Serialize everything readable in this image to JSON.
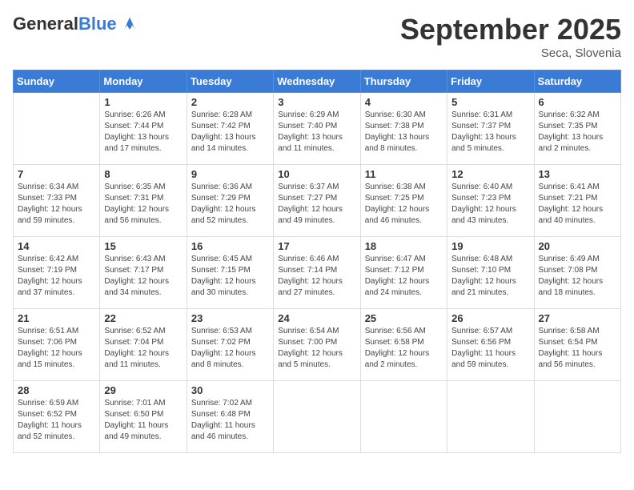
{
  "logo": {
    "general": "General",
    "blue": "Blue"
  },
  "header": {
    "month": "September 2025",
    "location": "Seca, Slovenia"
  },
  "weekdays": [
    "Sunday",
    "Monday",
    "Tuesday",
    "Wednesday",
    "Thursday",
    "Friday",
    "Saturday"
  ],
  "weeks": [
    [
      {
        "day": "",
        "sunrise": "",
        "sunset": "",
        "daylight": ""
      },
      {
        "day": "1",
        "sunrise": "Sunrise: 6:26 AM",
        "sunset": "Sunset: 7:44 PM",
        "daylight": "Daylight: 13 hours and 17 minutes."
      },
      {
        "day": "2",
        "sunrise": "Sunrise: 6:28 AM",
        "sunset": "Sunset: 7:42 PM",
        "daylight": "Daylight: 13 hours and 14 minutes."
      },
      {
        "day": "3",
        "sunrise": "Sunrise: 6:29 AM",
        "sunset": "Sunset: 7:40 PM",
        "daylight": "Daylight: 13 hours and 11 minutes."
      },
      {
        "day": "4",
        "sunrise": "Sunrise: 6:30 AM",
        "sunset": "Sunset: 7:38 PM",
        "daylight": "Daylight: 13 hours and 8 minutes."
      },
      {
        "day": "5",
        "sunrise": "Sunrise: 6:31 AM",
        "sunset": "Sunset: 7:37 PM",
        "daylight": "Daylight: 13 hours and 5 minutes."
      },
      {
        "day": "6",
        "sunrise": "Sunrise: 6:32 AM",
        "sunset": "Sunset: 7:35 PM",
        "daylight": "Daylight: 13 hours and 2 minutes."
      }
    ],
    [
      {
        "day": "7",
        "sunrise": "Sunrise: 6:34 AM",
        "sunset": "Sunset: 7:33 PM",
        "daylight": "Daylight: 12 hours and 59 minutes."
      },
      {
        "day": "8",
        "sunrise": "Sunrise: 6:35 AM",
        "sunset": "Sunset: 7:31 PM",
        "daylight": "Daylight: 12 hours and 56 minutes."
      },
      {
        "day": "9",
        "sunrise": "Sunrise: 6:36 AM",
        "sunset": "Sunset: 7:29 PM",
        "daylight": "Daylight: 12 hours and 52 minutes."
      },
      {
        "day": "10",
        "sunrise": "Sunrise: 6:37 AM",
        "sunset": "Sunset: 7:27 PM",
        "daylight": "Daylight: 12 hours and 49 minutes."
      },
      {
        "day": "11",
        "sunrise": "Sunrise: 6:38 AM",
        "sunset": "Sunset: 7:25 PM",
        "daylight": "Daylight: 12 hours and 46 minutes."
      },
      {
        "day": "12",
        "sunrise": "Sunrise: 6:40 AM",
        "sunset": "Sunset: 7:23 PM",
        "daylight": "Daylight: 12 hours and 43 minutes."
      },
      {
        "day": "13",
        "sunrise": "Sunrise: 6:41 AM",
        "sunset": "Sunset: 7:21 PM",
        "daylight": "Daylight: 12 hours and 40 minutes."
      }
    ],
    [
      {
        "day": "14",
        "sunrise": "Sunrise: 6:42 AM",
        "sunset": "Sunset: 7:19 PM",
        "daylight": "Daylight: 12 hours and 37 minutes."
      },
      {
        "day": "15",
        "sunrise": "Sunrise: 6:43 AM",
        "sunset": "Sunset: 7:17 PM",
        "daylight": "Daylight: 12 hours and 34 minutes."
      },
      {
        "day": "16",
        "sunrise": "Sunrise: 6:45 AM",
        "sunset": "Sunset: 7:15 PM",
        "daylight": "Daylight: 12 hours and 30 minutes."
      },
      {
        "day": "17",
        "sunrise": "Sunrise: 6:46 AM",
        "sunset": "Sunset: 7:14 PM",
        "daylight": "Daylight: 12 hours and 27 minutes."
      },
      {
        "day": "18",
        "sunrise": "Sunrise: 6:47 AM",
        "sunset": "Sunset: 7:12 PM",
        "daylight": "Daylight: 12 hours and 24 minutes."
      },
      {
        "day": "19",
        "sunrise": "Sunrise: 6:48 AM",
        "sunset": "Sunset: 7:10 PM",
        "daylight": "Daylight: 12 hours and 21 minutes."
      },
      {
        "day": "20",
        "sunrise": "Sunrise: 6:49 AM",
        "sunset": "Sunset: 7:08 PM",
        "daylight": "Daylight: 12 hours and 18 minutes."
      }
    ],
    [
      {
        "day": "21",
        "sunrise": "Sunrise: 6:51 AM",
        "sunset": "Sunset: 7:06 PM",
        "daylight": "Daylight: 12 hours and 15 minutes."
      },
      {
        "day": "22",
        "sunrise": "Sunrise: 6:52 AM",
        "sunset": "Sunset: 7:04 PM",
        "daylight": "Daylight: 12 hours and 11 minutes."
      },
      {
        "day": "23",
        "sunrise": "Sunrise: 6:53 AM",
        "sunset": "Sunset: 7:02 PM",
        "daylight": "Daylight: 12 hours and 8 minutes."
      },
      {
        "day": "24",
        "sunrise": "Sunrise: 6:54 AM",
        "sunset": "Sunset: 7:00 PM",
        "daylight": "Daylight: 12 hours and 5 minutes."
      },
      {
        "day": "25",
        "sunrise": "Sunrise: 6:56 AM",
        "sunset": "Sunset: 6:58 PM",
        "daylight": "Daylight: 12 hours and 2 minutes."
      },
      {
        "day": "26",
        "sunrise": "Sunrise: 6:57 AM",
        "sunset": "Sunset: 6:56 PM",
        "daylight": "Daylight: 11 hours and 59 minutes."
      },
      {
        "day": "27",
        "sunrise": "Sunrise: 6:58 AM",
        "sunset": "Sunset: 6:54 PM",
        "daylight": "Daylight: 11 hours and 56 minutes."
      }
    ],
    [
      {
        "day": "28",
        "sunrise": "Sunrise: 6:59 AM",
        "sunset": "Sunset: 6:52 PM",
        "daylight": "Daylight: 11 hours and 52 minutes."
      },
      {
        "day": "29",
        "sunrise": "Sunrise: 7:01 AM",
        "sunset": "Sunset: 6:50 PM",
        "daylight": "Daylight: 11 hours and 49 minutes."
      },
      {
        "day": "30",
        "sunrise": "Sunrise: 7:02 AM",
        "sunset": "Sunset: 6:48 PM",
        "daylight": "Daylight: 11 hours and 46 minutes."
      },
      {
        "day": "",
        "sunrise": "",
        "sunset": "",
        "daylight": ""
      },
      {
        "day": "",
        "sunrise": "",
        "sunset": "",
        "daylight": ""
      },
      {
        "day": "",
        "sunrise": "",
        "sunset": "",
        "daylight": ""
      },
      {
        "day": "",
        "sunrise": "",
        "sunset": "",
        "daylight": ""
      }
    ]
  ]
}
